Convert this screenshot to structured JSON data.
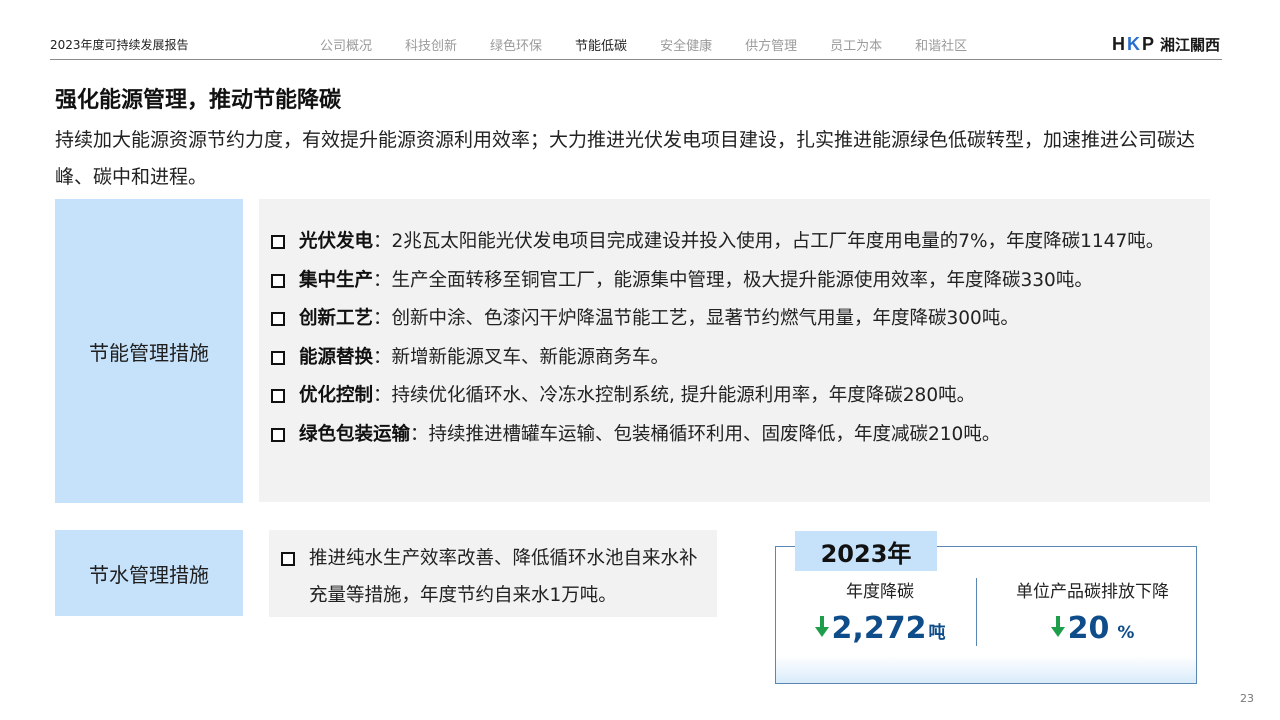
{
  "header": {
    "report_title": "2023年度可持续发展报告",
    "nav": [
      {
        "label": "公司概况",
        "active": false
      },
      {
        "label": "科技创新",
        "active": false
      },
      {
        "label": "绿色环保",
        "active": false
      },
      {
        "label": "节能低碳",
        "active": true
      },
      {
        "label": "安全健康",
        "active": false
      },
      {
        "label": "供方管理",
        "active": false
      },
      {
        "label": "员工为本",
        "active": false
      },
      {
        "label": "和谐社区",
        "active": false
      }
    ],
    "logo": {
      "mark_h": "H",
      "mark_k": "K",
      "mark_p": "P",
      "text": "湘江關西"
    }
  },
  "section": {
    "title": "强化能源管理，推动节能降碳",
    "intro": "持续加大能源资源节约力度，有效提升能源资源利用效率；大力推进光伏发电项目建设，扎实推进能源绿色低碳转型，加速推进公司碳达峰、碳中和进程。"
  },
  "energy": {
    "label": "节能管理措施",
    "measures": [
      {
        "name": "光伏发电",
        "text": "：2兆瓦太阳能光伏发电项目完成建设并投入使用，占工厂年度用电量的7%，年度降碳1147吨。"
      },
      {
        "name": "集中生产",
        "text": "：生产全面转移至铜官工厂，能源集中管理，极大提升能源使用效率，年度降碳330吨。"
      },
      {
        "name": "创新工艺",
        "text": "：创新中涂、色漆闪干炉降温节能工艺，显著节约燃气用量，年度降碳300吨。"
      },
      {
        "name": "能源替换",
        "text": "：新增新能源叉车、新能源商务车。"
      },
      {
        "name": "优化控制",
        "text": "：持续优化循环水、冷冻水控制系统, 提升能源利用率，年度降碳280吨。"
      },
      {
        "name": "绿色包装运输",
        "text": "：持续推进槽罐车运输、包装桶循环利用、固废降低，年度减碳210吨。"
      }
    ]
  },
  "water": {
    "label": "节水管理措施",
    "text": "推进纯水生产效率改善、降低循环水池自来水补充量等措施，年度节约自来水1万吨。"
  },
  "stats": {
    "year": "2023年",
    "items": [
      {
        "label": "年度降碳",
        "value": "2,272",
        "unit": "吨"
      },
      {
        "label": "单位产品碳排放下降",
        "value": "20",
        "unit": "%"
      }
    ],
    "colors": {
      "value": "#0f4c8a",
      "arrow": "#1e9e4a",
      "accent_bg": "#c6e2fb"
    }
  },
  "page_number": "23"
}
